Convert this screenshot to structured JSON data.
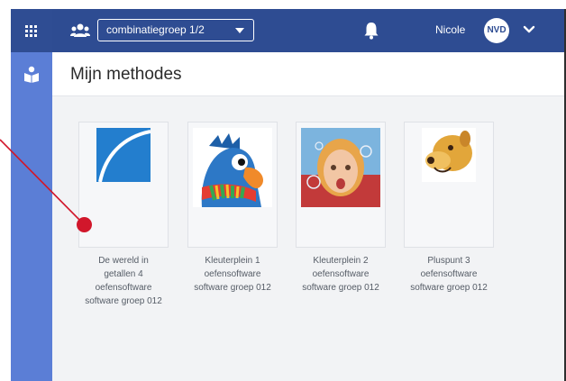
{
  "topbar": {
    "group_select_value": "combinatiegroep 1/2",
    "user_name": "Nicole",
    "avatar_initials": "NVD"
  },
  "header": {
    "title": "Mijn methodes"
  },
  "methods": [
    {
      "line1": "De wereld in",
      "line2": "getallen 4",
      "line3": "oefensoftware",
      "line4": "software groep 012"
    },
    {
      "line1": "Kleuterplein 1",
      "line2": "oefensoftware",
      "line3": "software groep 012"
    },
    {
      "line1": "Kleuterplein 2",
      "line2": "oefensoftware",
      "line3": "software groep 012"
    },
    {
      "line1": "Pluspunt 3",
      "line2": "oefensoftware",
      "line3": "software groep 012"
    }
  ],
  "colors": {
    "topbar": "#2e4c92",
    "rail": "#5b7ed6",
    "annotation": "#d1172b"
  },
  "icons": [
    "apps-grid-icon",
    "book-user-icon",
    "group-icon",
    "bell-icon",
    "chevron-down-icon"
  ]
}
